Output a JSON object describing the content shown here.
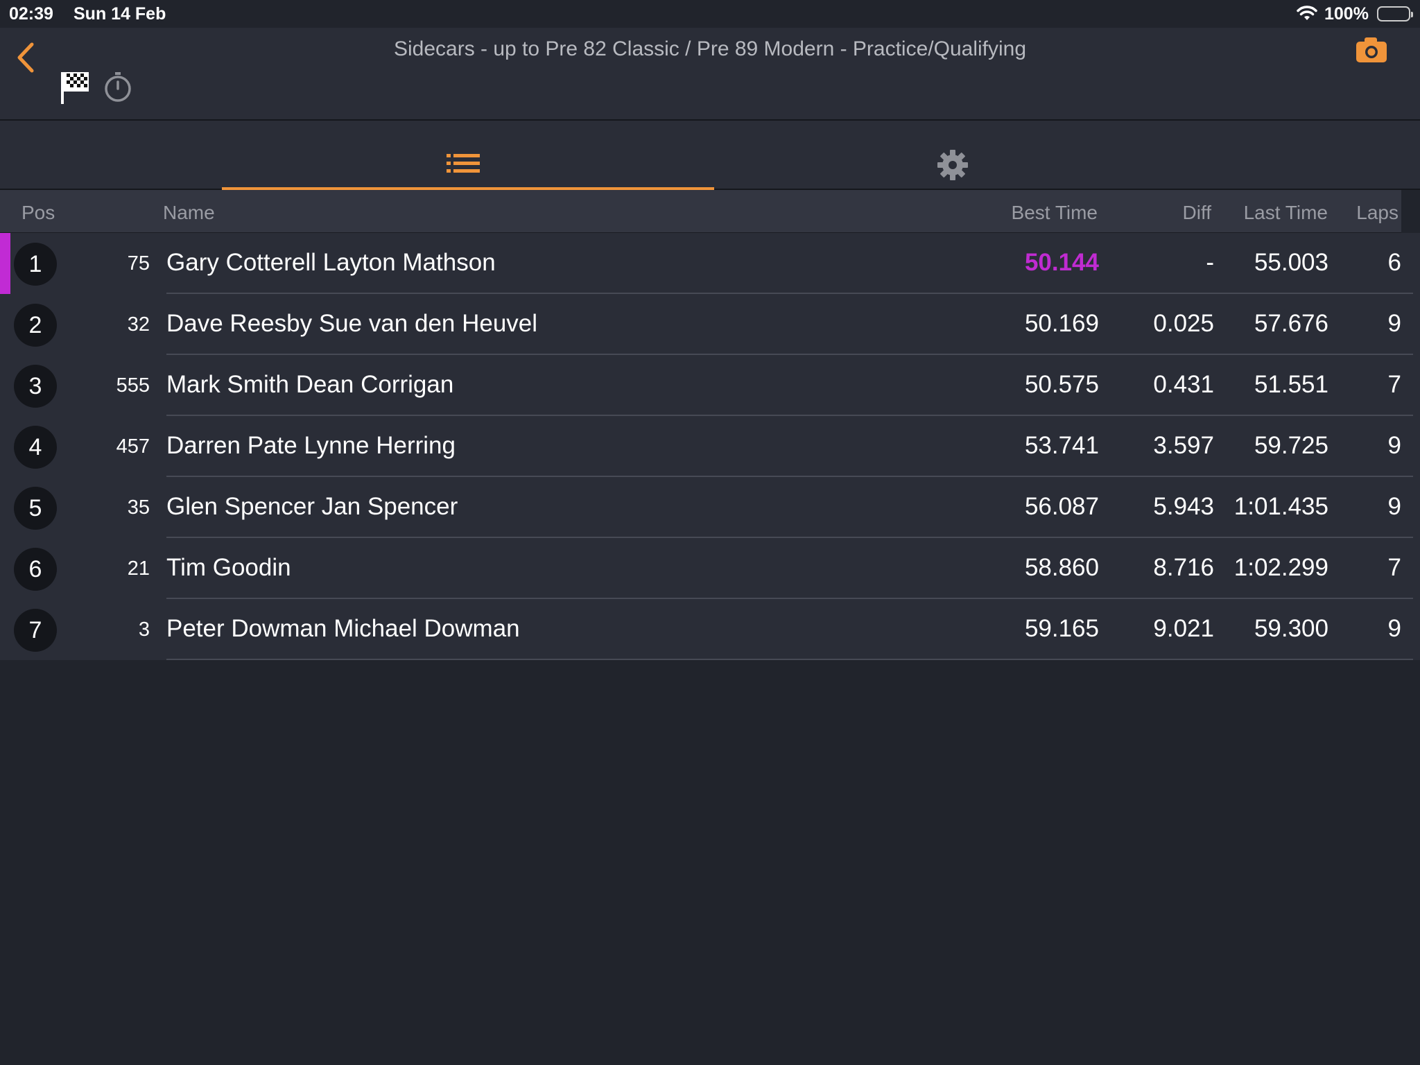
{
  "status_bar": {
    "time": "02:39",
    "date": "Sun 14 Feb",
    "battery": "100%"
  },
  "header": {
    "title": "Sidecars - up to Pre 82 Classic / Pre 89 Modern - Practice/Qualifying",
    "accent_color": "#f0943a",
    "icons": [
      "back-chevron",
      "checkered-flag",
      "stopwatch",
      "camera"
    ]
  },
  "tabs": [
    {
      "name": "results-list",
      "icon": "list-icon",
      "active": true
    },
    {
      "name": "settings",
      "icon": "gear-icon",
      "active": false
    }
  ],
  "table": {
    "columns": {
      "pos": "Pos",
      "name": "Name",
      "best": "Best Time",
      "diff": "Diff",
      "last": "Last Time",
      "laps": "Laps"
    },
    "fastest_color": "#c02bd1",
    "rows": [
      {
        "pos": "1",
        "number": "75",
        "name": "Gary Cotterell Layton Mathson",
        "best": "50.144",
        "diff": "-",
        "last": "55.003",
        "laps": "6"
      },
      {
        "pos": "2",
        "number": "32",
        "name": "Dave Reesby Sue van den Heuvel",
        "best": "50.169",
        "diff": "0.025",
        "last": "57.676",
        "laps": "9"
      },
      {
        "pos": "3",
        "number": "555",
        "name": "Mark Smith Dean Corrigan",
        "best": "50.575",
        "diff": "0.431",
        "last": "51.551",
        "laps": "7"
      },
      {
        "pos": "4",
        "number": "457",
        "name": "Darren Pate Lynne Herring",
        "best": "53.741",
        "diff": "3.597",
        "last": "59.725",
        "laps": "9"
      },
      {
        "pos": "5",
        "number": "35",
        "name": "Glen Spencer Jan Spencer",
        "best": "56.087",
        "diff": "5.943",
        "last": "1:01.435",
        "laps": "9"
      },
      {
        "pos": "6",
        "number": "21",
        "name": "Tim Goodin",
        "best": "58.860",
        "diff": "8.716",
        "last": "1:02.299",
        "laps": "7"
      },
      {
        "pos": "7",
        "number": "3",
        "name": "Peter Dowman Michael Dowman",
        "best": "59.165",
        "diff": "9.021",
        "last": "59.300",
        "laps": "9"
      }
    ]
  }
}
